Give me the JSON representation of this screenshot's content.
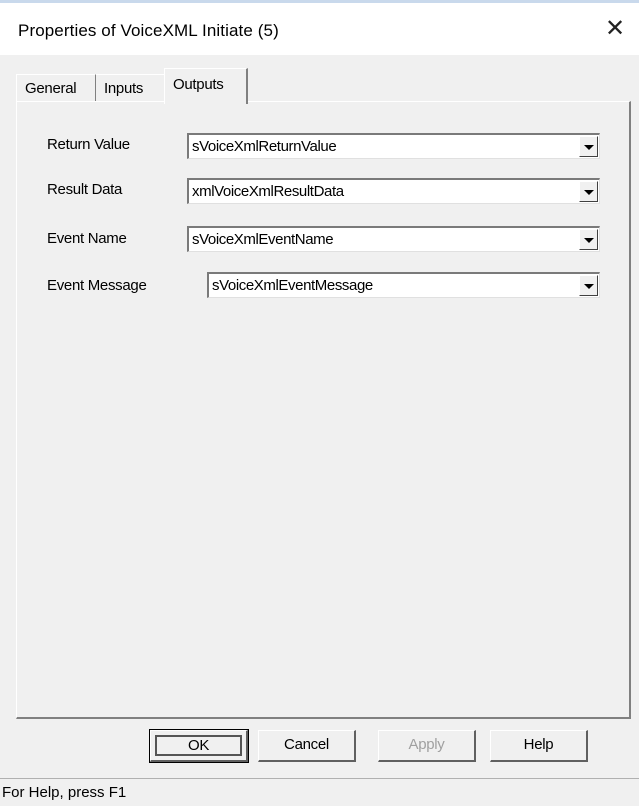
{
  "window": {
    "title": "Properties of VoiceXML Initiate (5)",
    "close_glyph": "✕"
  },
  "tabs": [
    {
      "label": "General",
      "selected": false
    },
    {
      "label": "Inputs",
      "selected": false
    },
    {
      "label": "Outputs",
      "selected": true
    }
  ],
  "fields": [
    {
      "label": "Return Value",
      "value": "sVoiceXmlReturnValue"
    },
    {
      "label": "Result Data",
      "value": "xmlVoiceXmlResultData"
    },
    {
      "label": "Event Name",
      "value": "sVoiceXmlEventName"
    },
    {
      "label": "Event Message",
      "value": "sVoiceXmlEventMessage"
    }
  ],
  "buttons": {
    "ok": "OK",
    "cancel": "Cancel",
    "apply": "Apply",
    "help": "Help"
  },
  "status_bar": {
    "text": "For Help, press F1"
  }
}
